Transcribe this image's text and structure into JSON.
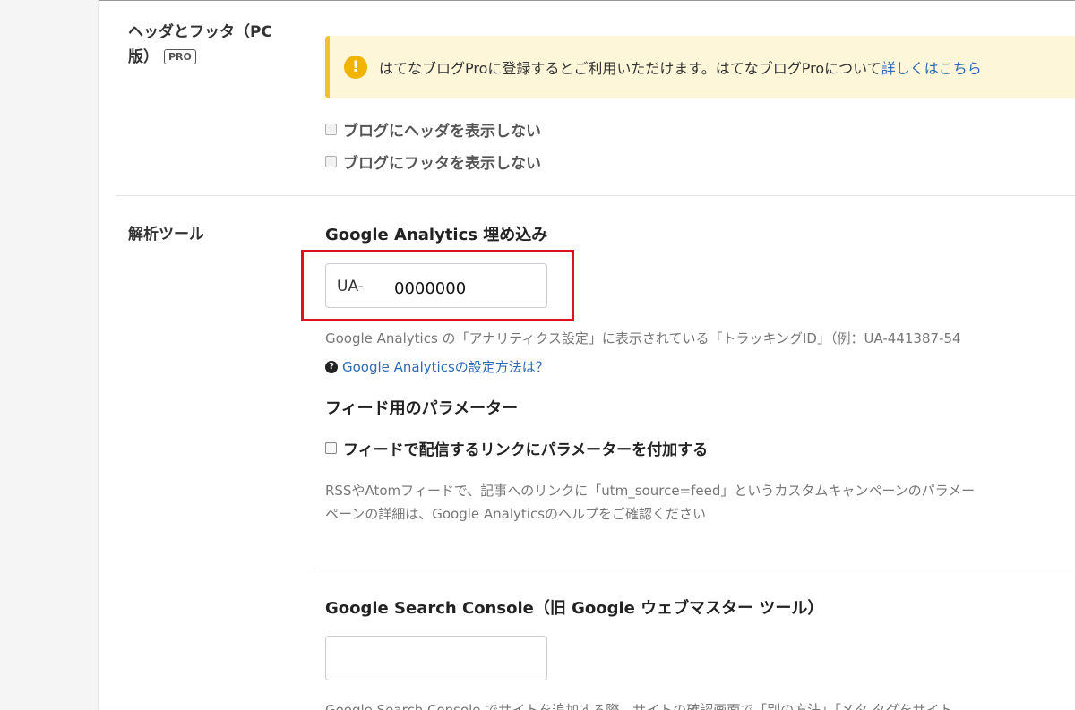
{
  "header_footer": {
    "label_line1": "ヘッダとフッタ（PC",
    "label_line2": "版）",
    "pro_badge": "PRO",
    "notice": {
      "icon": "exclamation-circle-icon",
      "text": "はてなブログProに登録するとご利用いただけます。はてなブログProについて",
      "link": "詳しくはこちら"
    },
    "options": [
      {
        "label": "ブログにヘッダを表示しない",
        "checked": false
      },
      {
        "label": "ブログにフッタを表示しない",
        "checked": false
      }
    ]
  },
  "analytics": {
    "label": "解析ツール",
    "ga_title": "Google Analytics 埋め込み",
    "ga_prefix": "UA-",
    "ga_value": "0000000",
    "ga_help": "Google Analytics の「アナリティクス設定」に表示されている「トラッキングID」（例：UA-441387-54",
    "ga_setup_link": "Google Analyticsの設定方法は？",
    "feed_title": "フィード用のパラメーター",
    "feed_option": {
      "label": "フィードで配信するリンクにパラメーターを付加する",
      "checked": false
    },
    "feed_help_line1": "RSSやAtomフィードで、記事へのリンクに「utm_source=feed」というカスタムキャンペーンのパラメー",
    "feed_help_line2": "ペーンの詳細は、Google Analyticsのヘルプをご確認ください",
    "gsc_title": "Google Search Console（旧 Google ウェブマスター ツール）",
    "gsc_value": "",
    "gsc_help": "Google Search Console でサイトを追加する際、サイトの確認画面で「別の方法」「メタ タグをサイト"
  },
  "colors": {
    "accent_link": "#2d6bb5",
    "highlight": "#e01020",
    "notice_bg": "#fdf6d9",
    "notice_border": "#f0c030"
  }
}
